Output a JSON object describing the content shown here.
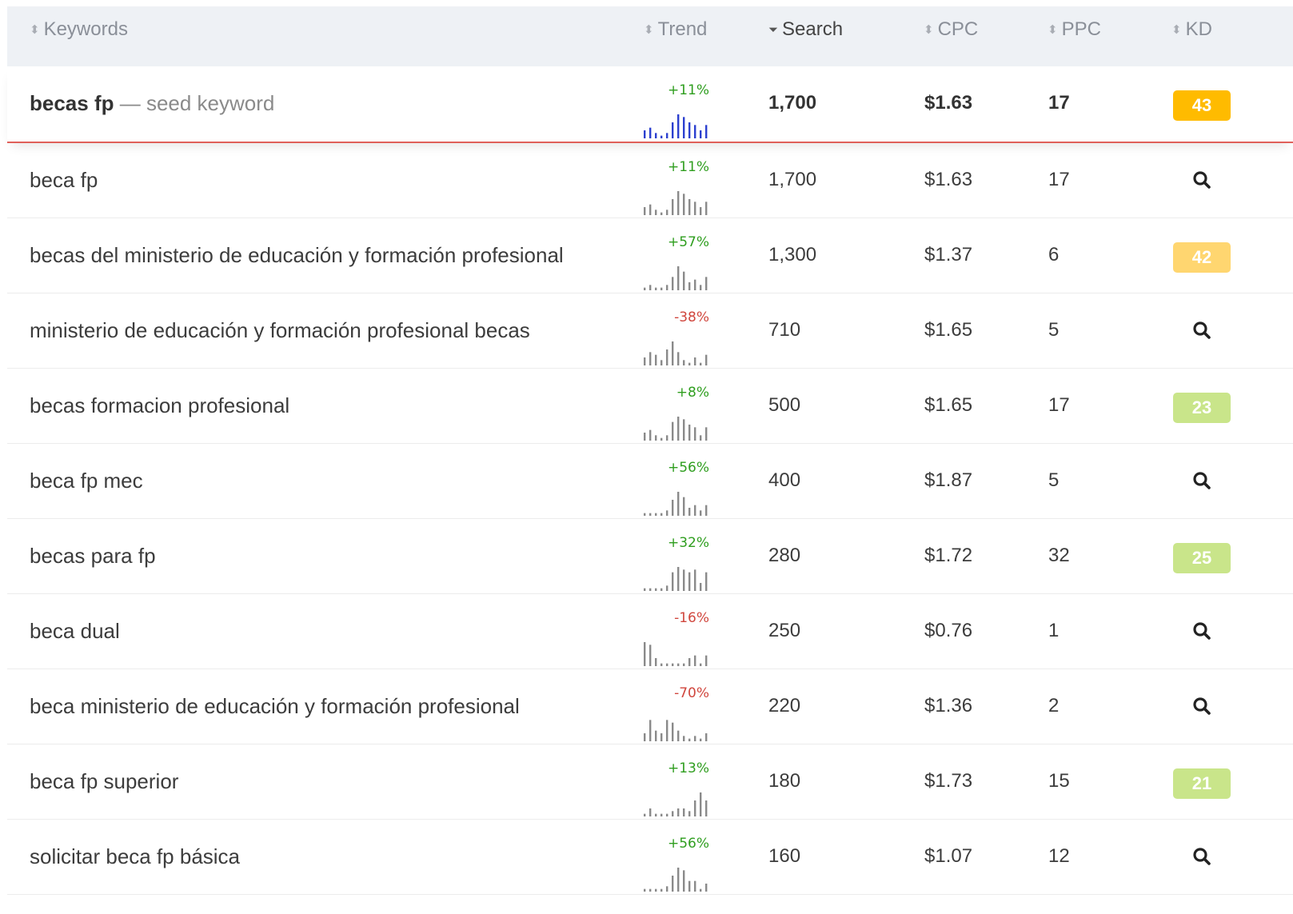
{
  "header": {
    "columns": [
      {
        "label": "Keywords",
        "sort": "⬍",
        "active": false
      },
      {
        "label": "Trend",
        "sort": "⬍",
        "active": false
      },
      {
        "label": "Search",
        "sort": "⏷",
        "active": true
      },
      {
        "label": "CPC",
        "sort": "⬍",
        "active": false
      },
      {
        "label": "PPC",
        "sort": "⬍",
        "active": false
      },
      {
        "label": "KD",
        "sort": "⬍",
        "active": false
      }
    ]
  },
  "colors": {
    "spark_seed": "#2b3fcf",
    "spark": "#8a8a8a",
    "kd_orange": "#ffbb00",
    "kd_light_orange": "#ffd670",
    "kd_light_green": "#c9e58a",
    "seed_border": "#e0605a"
  },
  "rows": [
    {
      "keyword": "becas fp",
      "suffix": " — seed keyword",
      "seed": true,
      "trend": "+11%",
      "trend_dir": "pos",
      "spark": [
        3,
        4,
        2,
        1,
        2,
        6,
        9,
        8,
        6,
        5,
        3,
        5
      ],
      "search": "1,700",
      "cpc": "$1.63",
      "ppc": "17",
      "kd": "43",
      "kd_color": "#ffbb00"
    },
    {
      "keyword": "beca fp",
      "trend": "+11%",
      "trend_dir": "pos",
      "spark": [
        3,
        4,
        2,
        1,
        2,
        6,
        9,
        8,
        6,
        5,
        3,
        5
      ],
      "search": "1,700",
      "cpc": "$1.63",
      "ppc": "17",
      "kd": "",
      "kd_icon": "search-icon"
    },
    {
      "keyword": "becas del ministerio de educación y formación profesional",
      "trend": "+57%",
      "trend_dir": "pos",
      "spark": [
        1,
        2,
        1,
        1,
        2,
        5,
        9,
        7,
        3,
        4,
        2,
        5
      ],
      "search": "1,300",
      "cpc": "$1.37",
      "ppc": "6",
      "kd": "42",
      "kd_color": "#ffd670"
    },
    {
      "keyword": "ministerio de educación y formación profesional becas",
      "trend": "-38%",
      "trend_dir": "neg",
      "spark": [
        3,
        5,
        4,
        2,
        6,
        9,
        5,
        2,
        1,
        3,
        1,
        4
      ],
      "search": "710",
      "cpc": "$1.65",
      "ppc": "5",
      "kd": "",
      "kd_icon": "search-icon"
    },
    {
      "keyword": "becas formacion profesional",
      "trend": "+8%",
      "trend_dir": "pos",
      "spark": [
        3,
        4,
        2,
        1,
        2,
        7,
        9,
        8,
        6,
        5,
        2,
        5
      ],
      "search": "500",
      "cpc": "$1.65",
      "ppc": "17",
      "kd": "23",
      "kd_color": "#c9e58a"
    },
    {
      "keyword": "beca fp mec",
      "trend": "+56%",
      "trend_dir": "pos",
      "spark": [
        1,
        1,
        1,
        1,
        2,
        6,
        9,
        7,
        3,
        4,
        2,
        4
      ],
      "search": "400",
      "cpc": "$1.87",
      "ppc": "5",
      "kd": "",
      "kd_icon": "search-icon"
    },
    {
      "keyword": "becas para fp",
      "trend": "+32%",
      "trend_dir": "pos",
      "spark": [
        1,
        1,
        1,
        1,
        2,
        7,
        9,
        8,
        7,
        8,
        3,
        7
      ],
      "search": "280",
      "cpc": "$1.72",
      "ppc": "32",
      "kd": "25",
      "kd_color": "#c9e58a"
    },
    {
      "keyword": "beca dual",
      "trend": "-16%",
      "trend_dir": "neg",
      "spark": [
        9,
        8,
        3,
        1,
        1,
        1,
        1,
        1,
        3,
        4,
        1,
        4
      ],
      "search": "250",
      "cpc": "$0.76",
      "ppc": "1",
      "kd": "",
      "kd_icon": "search-icon"
    },
    {
      "keyword": "beca ministerio de educación y formación profesional",
      "trend": "-70%",
      "trend_dir": "neg",
      "spark": [
        3,
        8,
        4,
        3,
        8,
        7,
        4,
        2,
        1,
        2,
        1,
        3
      ],
      "search": "220",
      "cpc": "$1.36",
      "ppc": "2",
      "kd": "",
      "kd_icon": "search-icon"
    },
    {
      "keyword": "beca fp superior",
      "trend": "+13%",
      "trend_dir": "pos",
      "spark": [
        1,
        3,
        1,
        1,
        1,
        2,
        3,
        3,
        2,
        6,
        9,
        6
      ],
      "search": "180",
      "cpc": "$1.73",
      "ppc": "15",
      "kd": "21",
      "kd_color": "#c9e58a"
    },
    {
      "keyword": "solicitar beca fp básica",
      "trend": "+56%",
      "trend_dir": "pos",
      "spark": [
        1,
        1,
        1,
        1,
        2,
        6,
        9,
        8,
        4,
        4,
        1,
        3
      ],
      "search": "160",
      "cpc": "$1.07",
      "ppc": "12",
      "kd": "",
      "kd_icon": "search-icon"
    }
  ]
}
